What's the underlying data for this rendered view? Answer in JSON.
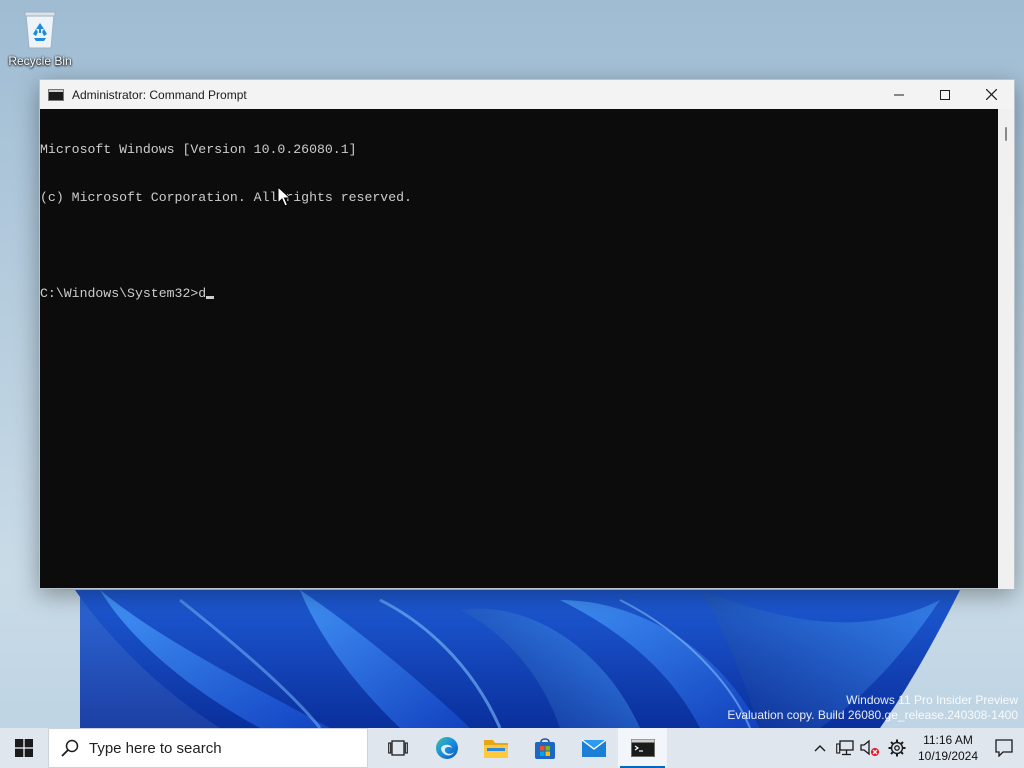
{
  "desktop": {
    "icons": [
      {
        "label": "Recycle Bin",
        "icon": "recycle-bin-icon"
      }
    ]
  },
  "window": {
    "title": "Administrator: Command Prompt",
    "controls": {
      "minimize": "minimize-icon",
      "maximize": "maximize-icon",
      "close": "close-icon"
    },
    "console": {
      "lines": [
        "Microsoft Windows [Version 10.0.26080.1]",
        "(c) Microsoft Corporation. All rights reserved.",
        "",
        "C:\\Windows\\System32>d"
      ],
      "text_color": "#cccccc",
      "background": "#0c0c0c"
    }
  },
  "watermark": {
    "line1": "Windows 11 Pro Insider Preview",
    "line2": "Evaluation copy. Build 26080.ge_release.240308-1400"
  },
  "taskbar": {
    "search_placeholder": "Type here to search",
    "apps": [
      {
        "name": "task-view",
        "icon": "task-view-icon"
      },
      {
        "name": "edge",
        "icon": "edge-icon"
      },
      {
        "name": "file-explorer",
        "icon": "folder-icon"
      },
      {
        "name": "microsoft-store",
        "icon": "store-icon"
      },
      {
        "name": "mail",
        "icon": "mail-icon"
      },
      {
        "name": "command-prompt",
        "icon": "terminal-icon",
        "active": true
      }
    ],
    "tray": {
      "clock_time": "11:16 AM",
      "clock_date": "10/19/2024"
    },
    "accent": "#0067c0"
  }
}
